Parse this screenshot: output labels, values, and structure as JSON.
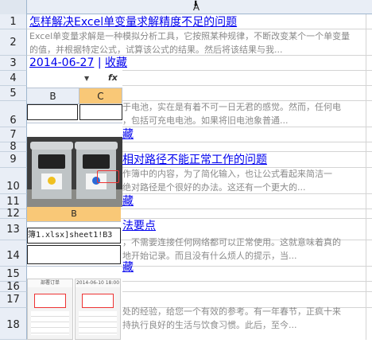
{
  "sheet": {
    "column_header": "A",
    "row_numbers": [
      "1",
      "2",
      "3",
      "4",
      "5",
      "6",
      "7",
      "8",
      "9",
      "10",
      "11",
      "12",
      "13",
      "14",
      "15",
      "16",
      "17",
      "18"
    ]
  },
  "articles": [
    {
      "title": "怎样解决Excel单变量求解精度不足的问题",
      "summary_line1": "Excel单变量求解是一种模拟分析工具，它按照某种规律，不断改变某个一个单变量",
      "summary_line2": "的值，并根据特定公式，试算该公式的结果。然后将该结果与我...",
      "date": "2014-06-27",
      "separator": "|",
      "favorite": "收藏"
    },
    {
      "summary_line1": "于电池，实在是有着不可一日无君的感觉。然而，任何电",
      "summary_line2": "，包括可充电电池。如果将旧电池象普通...",
      "favorite_fragment": "藏"
    },
    {
      "title_fragment": "相对路径不能正常工作的问题",
      "summary_line1": "作簿中的内容，为了简化输入，也让公式看起来简洁一",
      "summary_line2": "绝对路径是个很好的办法。这还有一个更大的...",
      "favorite_fragment": "藏"
    },
    {
      "title_fragment": "法要点",
      "summary_line1": "，不需要连接任何网络都可以正常使用。这就意味着真的",
      "summary_line2": "地开始记录。而且没有什么烦人的提示，当...",
      "favorite_fragment": "藏"
    },
    {
      "summary_line1": "处的经验，给您一个有效的参考。有一年春节，正疯十来",
      "summary_line2": "持执行良好的生活与饮食习惯。此后，至今..."
    }
  ],
  "thumbnails": {
    "formula_bar": {
      "fx": "fx",
      "col_b": "B",
      "col_c": "C"
    },
    "path_formula": {
      "col": "B",
      "formula": "簿1.xlsx]sheet1!B3"
    },
    "phone_screens": {
      "caption_left": "部署订单",
      "caption_right": "2014-06-10 18:00"
    }
  },
  "colors": {
    "link": "#0000ee",
    "summary": "#8a8a8a",
    "header_bg": "#e9eef6",
    "selected_col": "#f9c877"
  }
}
